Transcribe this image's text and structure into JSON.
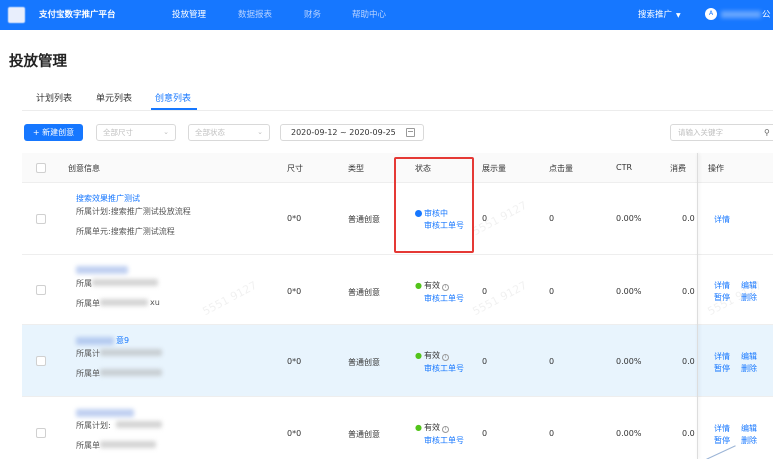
{
  "topnav": {
    "brand": "支付宝数字推广平台",
    "items": [
      "投放管理",
      "数据报表",
      "财务",
      "帮助中心"
    ],
    "right_menu": "搜索推广",
    "avatar_letter": "A",
    "user_tail": "公",
    "colors": {
      "bar": "#1677ff"
    }
  },
  "page": {
    "title": "投放管理"
  },
  "tabs": [
    "计划列表",
    "单元列表",
    "创意列表"
  ],
  "active_tab": "创意列表",
  "toolbar": {
    "new_button": "+ 新建创意",
    "size_filter": "全部尺寸",
    "status_filter": "全部状态",
    "date_range": "2020-09-12 ~ 2020-09-25",
    "search_placeholder": "请输入关键字"
  },
  "table": {
    "columns": [
      "创意信息",
      "尺寸",
      "类型",
      "状态",
      "展示量",
      "点击量",
      "CTR",
      "消费",
      "操作"
    ],
    "rows": [
      {
        "title": "搜索效果推广测试",
        "plan": "所属计划:搜索推广测试投放流程",
        "unit": "所属单元:搜索推广测试流程",
        "size": "0*0",
        "type": "普通创意",
        "status": "审核中",
        "status_link": "审核工单号",
        "impressions": "0",
        "clicks": "0",
        "ctr": "0.00%",
        "cost": "0.0",
        "actions": [
          "详情"
        ]
      },
      {
        "plan": "所属",
        "unit": "所属单",
        "unit_tail": "xu",
        "size": "0*0",
        "type": "普通创意",
        "status": "有效",
        "status_link": "审核工单号",
        "impressions": "0",
        "clicks": "0",
        "ctr": "0.00%",
        "cost": "0.0",
        "actions": [
          "详情",
          "编辑",
          "暂停",
          "删除"
        ]
      },
      {
        "title_tail": "意9",
        "plan": "所属计",
        "unit": "所属单",
        "size": "0*0",
        "type": "普通创意",
        "status": "有效",
        "status_link": "审核工单号",
        "impressions": "0",
        "clicks": "0",
        "ctr": "0.00%",
        "cost": "0.0",
        "actions": [
          "详情",
          "编辑",
          "暂停",
          "删除"
        ]
      },
      {
        "plan": "所属计划:",
        "unit": "所属单",
        "size": "0*0",
        "type": "普通创意",
        "status": "有效",
        "status_link": "审核工单号",
        "impressions": "0",
        "clicks": "0",
        "ctr": "0.00%",
        "cost": "0.0",
        "actions": [
          "详情",
          "编辑",
          "暂停",
          "删除"
        ]
      }
    ]
  },
  "watermark_text": "5551 9127",
  "highlight_color": "#e53935"
}
